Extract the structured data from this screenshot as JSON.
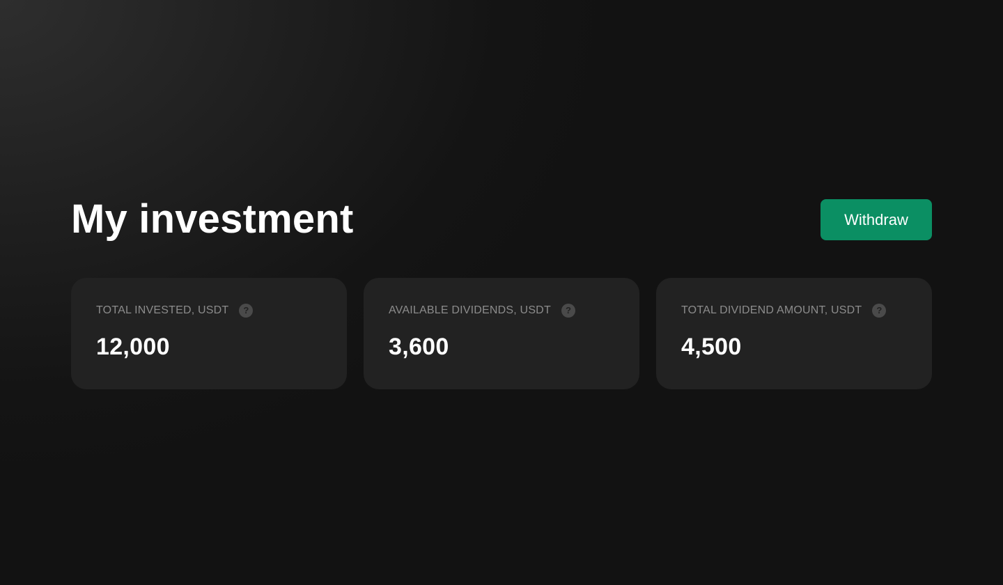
{
  "header": {
    "title": "My investment",
    "withdraw_label": "Withdraw"
  },
  "cards": [
    {
      "label": "TOTAL INVESTED, USDT",
      "value": "12,000",
      "help_icon": "question-circle-icon"
    },
    {
      "label": "AVAILABLE DIVIDENDS, USDT",
      "value": "3,600",
      "help_icon": "question-circle-icon"
    },
    {
      "label": "TOTAL DIVIDEND AMOUNT, USDT",
      "value": "4,500",
      "help_icon": "question-circle-icon"
    }
  ],
  "colors": {
    "accent": "#0b8f63",
    "card_background": "#222222",
    "page_background": "#141414",
    "label_text": "#8c8c8c"
  }
}
